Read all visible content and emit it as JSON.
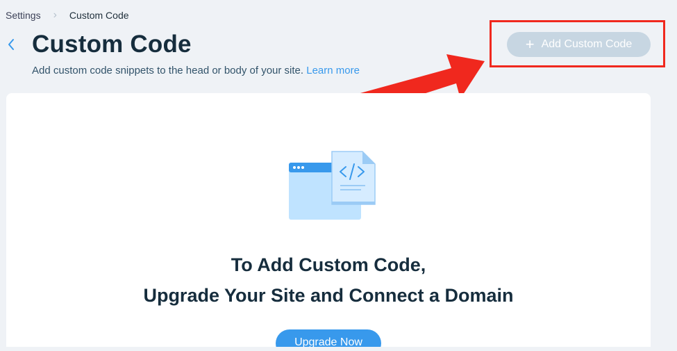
{
  "breadcrumb": {
    "root": "Settings",
    "current": "Custom Code"
  },
  "header": {
    "title": "Custom Code",
    "subtitle": "Add custom code snippets to the head or body of your site.",
    "learn_more": "Learn more"
  },
  "actions": {
    "add_custom_code": "Add Custom Code",
    "add_custom_code_state": "disabled"
  },
  "empty_state": {
    "line1": "To Add Custom Code,",
    "line2": "Upgrade Your Site and Connect a Domain",
    "upgrade_button": "Upgrade Now",
    "icon": "code-file-icon"
  },
  "colors": {
    "accent": "#3899ec",
    "annotation": "#f0281e",
    "disabled_button": "#c7d6e2",
    "background": "#eff2f6"
  }
}
